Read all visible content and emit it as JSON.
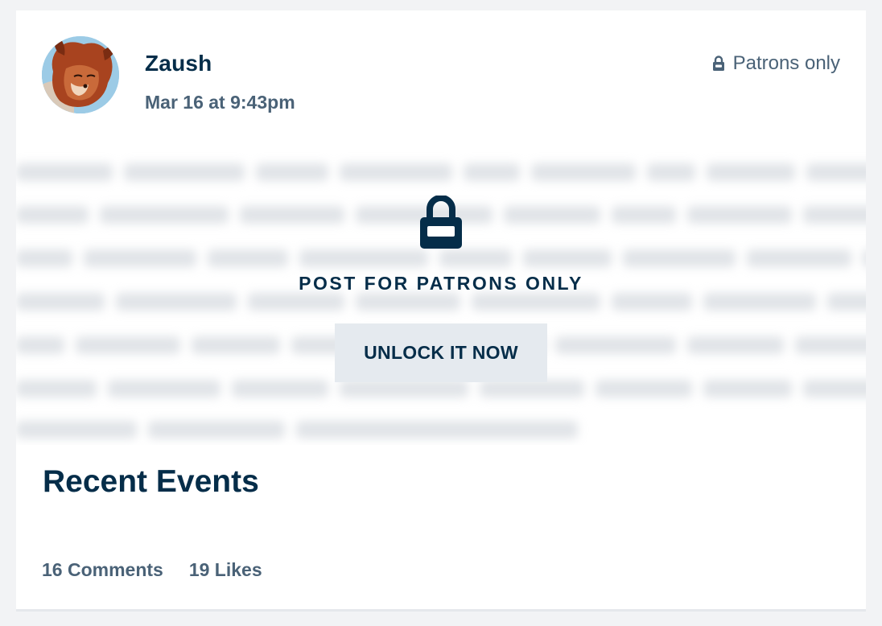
{
  "post": {
    "author": "Zaush",
    "date": "Mar 16 at 9:43pm",
    "visibility_label": "Patrons only",
    "locked_title": "POST FOR PATRONS ONLY",
    "unlock_button": "UNLOCK IT NOW",
    "section_title": "Recent Events",
    "comments": "16 Comments",
    "likes": "19 Likes"
  },
  "icons": {
    "visibility": "lock-icon",
    "locked": "lock-icon",
    "avatar": "avatar-image"
  },
  "colors": {
    "background": "#f2f3f5",
    "card": "#ffffff",
    "primary_text": "#052d49",
    "secondary_text": "#4a6277",
    "button_bg": "#e5eaef"
  }
}
